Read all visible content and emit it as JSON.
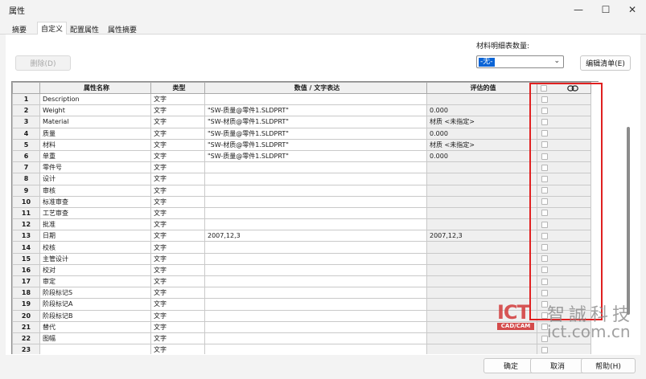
{
  "window": {
    "title": "属性",
    "minimize_glyph": "—",
    "maximize_glyph": "☐",
    "close_glyph": "✕"
  },
  "tabs": [
    {
      "label": "摘要"
    },
    {
      "label": "自定义"
    },
    {
      "label": "配置属性"
    },
    {
      "label": "属性摘要"
    }
  ],
  "active_tab": "自定义",
  "toolbar": {
    "delete_label": "删除(D)",
    "bom_qty_label": "材料明细表数量:",
    "bom_qty_value": "-无-",
    "edit_list_label": "编辑清单(E)"
  },
  "table": {
    "headers": [
      "",
      "属性名称",
      "类型",
      "数值 / 文字表达",
      "评估的值",
      ""
    ],
    "rows": [
      {
        "n": "1",
        "name": "Description",
        "type": "文字",
        "value": "",
        "eval": ""
      },
      {
        "n": "2",
        "name": "Weight",
        "type": "文字",
        "value": "\"SW-质量@零件1.SLDPRT\"",
        "eval": "0.000"
      },
      {
        "n": "3",
        "name": "Material",
        "type": "文字",
        "value": "\"SW-材质@零件1.SLDPRT\"",
        "eval": "材质 <未指定>"
      },
      {
        "n": "4",
        "name": "质量",
        "type": "文字",
        "value": "\"SW-质量@零件1.SLDPRT\"",
        "eval": "0.000"
      },
      {
        "n": "5",
        "name": "材料",
        "type": "文字",
        "value": "\"SW-材质@零件1.SLDPRT\"",
        "eval": "材质 <未指定>"
      },
      {
        "n": "6",
        "name": "单重",
        "type": "文字",
        "value": "\"SW-质量@零件1.SLDPRT\"",
        "eval": "0.000"
      },
      {
        "n": "7",
        "name": "零件号",
        "type": "文字",
        "value": "",
        "eval": ""
      },
      {
        "n": "8",
        "name": "设计",
        "type": "文字",
        "value": "",
        "eval": ""
      },
      {
        "n": "9",
        "name": "审核",
        "type": "文字",
        "value": "",
        "eval": ""
      },
      {
        "n": "10",
        "name": "标准审查",
        "type": "文字",
        "value": "",
        "eval": ""
      },
      {
        "n": "11",
        "name": "工艺审查",
        "type": "文字",
        "value": "",
        "eval": ""
      },
      {
        "n": "12",
        "name": "批准",
        "type": "文字",
        "value": "",
        "eval": ""
      },
      {
        "n": "13",
        "name": "日期",
        "type": "文字",
        "value": "2007,12,3",
        "eval": "2007,12,3"
      },
      {
        "n": "14",
        "name": "校核",
        "type": "文字",
        "value": "",
        "eval": ""
      },
      {
        "n": "15",
        "name": "主管设计",
        "type": "文字",
        "value": "",
        "eval": ""
      },
      {
        "n": "16",
        "name": "校对",
        "type": "文字",
        "value": "",
        "eval": ""
      },
      {
        "n": "17",
        "name": "审定",
        "type": "文字",
        "value": "",
        "eval": ""
      },
      {
        "n": "18",
        "name": "阶段标记S",
        "type": "文字",
        "value": "",
        "eval": ""
      },
      {
        "n": "19",
        "name": "阶段标记A",
        "type": "文字",
        "value": "",
        "eval": ""
      },
      {
        "n": "20",
        "name": "阶段标记B",
        "type": "文字",
        "value": "",
        "eval": ""
      },
      {
        "n": "21",
        "name": "替代",
        "type": "文字",
        "value": "",
        "eval": ""
      },
      {
        "n": "22",
        "name": "图幅",
        "type": "文字",
        "value": "",
        "eval": ""
      },
      {
        "n": "23",
        "name": "",
        "type": "文字",
        "value": "",
        "eval": ""
      }
    ]
  },
  "watermark": {
    "logo_text": "ICT",
    "logo_sub": "CAD/CAM",
    "company": "智誠科技",
    "site": "ict.com.cn"
  },
  "footer": {
    "ok_label": "确定",
    "cancel_label": "取消",
    "help_label": "帮助(H)"
  },
  "colors": {
    "highlight_box": "#e02020",
    "selection_blue": "#0a64d6",
    "watermark_red": "#c62828"
  }
}
